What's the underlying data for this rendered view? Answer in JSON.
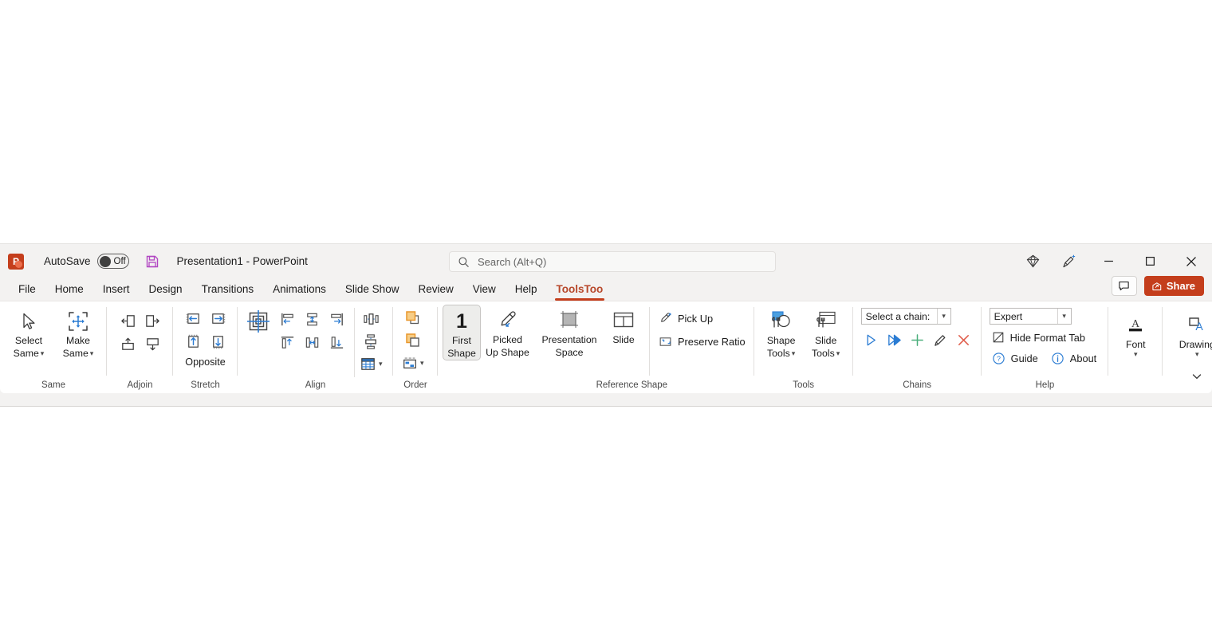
{
  "titlebar": {
    "app_icon": "powerpoint-logo",
    "autosave_label": "AutoSave",
    "autosave_state": "Off",
    "save_icon": "save-icon",
    "document_title": "Presentation1  -  PowerPoint",
    "search_placeholder": "Search (Alt+Q)",
    "search_value": "",
    "right_icons": [
      "copilot-diamond-icon",
      "ink-pen-icon"
    ],
    "window_controls": [
      "minimize",
      "maximize",
      "close"
    ]
  },
  "tabs": [
    {
      "label": "File",
      "active": false
    },
    {
      "label": "Home",
      "active": false
    },
    {
      "label": "Insert",
      "active": false
    },
    {
      "label": "Design",
      "active": false
    },
    {
      "label": "Transitions",
      "active": false
    },
    {
      "label": "Animations",
      "active": false
    },
    {
      "label": "Slide Show",
      "active": false
    },
    {
      "label": "Review",
      "active": false
    },
    {
      "label": "View",
      "active": false
    },
    {
      "label": "Help",
      "active": false
    },
    {
      "label": "ToolsToo",
      "active": true
    }
  ],
  "tabstrip_right": {
    "comments_icon": "comment-icon",
    "share_label": "Share",
    "share_icon": "share-icon",
    "share_color": "#c43e1c"
  },
  "ribbon": {
    "accent_color": "#c43e1c",
    "icon_blue": "#2b7cd3",
    "icon_orange": "#e8a33d",
    "groups": [
      {
        "name": "same",
        "label": "Same",
        "buttons": [
          {
            "name": "select-same",
            "line1": "Select",
            "line2": "Same",
            "dropdown": true,
            "icon": "cursor-arrow-icon"
          },
          {
            "name": "make-same",
            "line1": "Make",
            "line2": "Same",
            "dropdown": true,
            "icon": "resize-arrows-icon"
          }
        ]
      },
      {
        "name": "adjoin",
        "label": "Adjoin",
        "icons": [
          {
            "name": "adjoin-left-icon"
          },
          {
            "name": "adjoin-right-icon"
          },
          {
            "name": "adjoin-up-icon"
          },
          {
            "name": "adjoin-down-icon"
          }
        ]
      },
      {
        "name": "stretch",
        "label": "Stretch",
        "sublabel": "Opposite",
        "icons": [
          {
            "name": "stretch-left-icon"
          },
          {
            "name": "stretch-right-icon"
          },
          {
            "name": "stretch-up-icon"
          },
          {
            "name": "stretch-down-icon"
          }
        ]
      },
      {
        "name": "align",
        "label": "Align",
        "icons": [
          {
            "name": "align-center-target-icon"
          },
          {
            "name": "align-left-icon"
          },
          {
            "name": "align-middle-icon"
          },
          {
            "name": "align-right-icon"
          },
          {
            "name": "align-top-icon"
          },
          {
            "name": "align-center-icon"
          },
          {
            "name": "align-bottom-icon"
          },
          {
            "name": "distribute-horizontal-icon"
          },
          {
            "name": "distribute-vertical-icon"
          },
          {
            "name": "grid-table-icon"
          }
        ]
      },
      {
        "name": "order",
        "label": "Order",
        "icons": [
          {
            "name": "bring-to-front-icon"
          },
          {
            "name": "send-to-back-icon"
          },
          {
            "name": "selection-pane-icon"
          }
        ]
      },
      {
        "name": "reference-shape",
        "label": "Reference Shape",
        "buttons": [
          {
            "name": "first-shape",
            "line1": "First",
            "line2": "Shape",
            "icon": "number-one-icon",
            "selected": true
          },
          {
            "name": "picked-up-shape",
            "line1": "Picked",
            "line2": "Up Shape",
            "icon": "eyedropper-icon",
            "selected": false
          },
          {
            "name": "presentation-space",
            "line1": "Presentation",
            "line2": "Space",
            "icon": "presentation-space-icon",
            "selected": false
          },
          {
            "name": "slide",
            "line1": "Slide",
            "line2": "",
            "icon": "slide-icon",
            "selected": false
          }
        ],
        "commands": [
          {
            "name": "pick-up",
            "label": "Pick Up",
            "icon": "eyedropper-small-icon"
          },
          {
            "name": "preserve-ratio",
            "label": "Preserve Ratio",
            "icon": "preserve-ratio-icon"
          }
        ]
      },
      {
        "name": "tools",
        "label": "Tools",
        "buttons": [
          {
            "name": "shape-tools",
            "line1": "Shape",
            "line2": "Tools",
            "dropdown": true,
            "icon": "shape-tools-icon"
          },
          {
            "name": "slide-tools",
            "line1": "Slide",
            "line2": "Tools",
            "dropdown": true,
            "icon": "slide-tools-icon"
          }
        ]
      },
      {
        "name": "chains",
        "label": "Chains",
        "combo": {
          "name": "chain-select",
          "value": "Select a chain:"
        },
        "icons": [
          {
            "name": "run-chain-icon",
            "color": "#2b7cd3"
          },
          {
            "name": "run-all-chains-icon",
            "color": "#2b7cd3"
          },
          {
            "name": "add-chain-icon",
            "color": "#4caf7d"
          },
          {
            "name": "edit-chain-icon",
            "color": "#3a3a3a"
          },
          {
            "name": "delete-chain-icon",
            "color": "#e05c4a"
          }
        ]
      },
      {
        "name": "help",
        "label": "Help",
        "combo": {
          "name": "mode-select",
          "value": "Expert"
        },
        "commands": [
          {
            "name": "hide-format-tab",
            "label": "Hide Format Tab",
            "icon": "hide-format-tab-icon"
          },
          {
            "name": "guide",
            "label": "Guide",
            "icon": "question-circle-icon"
          },
          {
            "name": "about",
            "label": "About",
            "icon": "info-circle-icon"
          }
        ]
      },
      {
        "name": "font",
        "label": "",
        "buttons": [
          {
            "name": "font",
            "line1": "Font",
            "line2": "",
            "dropdown": true,
            "icon": "font-a-icon"
          }
        ]
      },
      {
        "name": "drawing",
        "label": "",
        "buttons": [
          {
            "name": "drawing",
            "line1": "Drawing",
            "line2": "",
            "dropdown": true,
            "icon": "drawing-icon"
          }
        ]
      }
    ],
    "collapse_icon": "chevron-down-icon"
  }
}
